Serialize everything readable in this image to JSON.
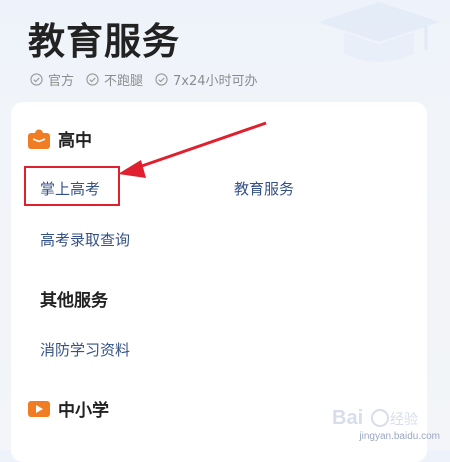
{
  "header": {
    "title": "教育服务",
    "badges": [
      "官方",
      "不跑腿",
      "7x24小时可办"
    ]
  },
  "sections": [
    {
      "title": "高中",
      "icon": "book-icon"
    },
    {
      "title": "其他服务"
    },
    {
      "title": "中小学",
      "icon": "video-icon"
    }
  ],
  "links": {
    "high_school": [
      "掌上高考",
      "教育服务",
      "高考录取查询"
    ],
    "other": [
      "消防学习资料"
    ]
  },
  "watermark": {
    "url": "jingyan.baidu.com"
  },
  "colors": {
    "accent": "#f07c24",
    "link": "#355287",
    "highlight": "#e0202e"
  }
}
